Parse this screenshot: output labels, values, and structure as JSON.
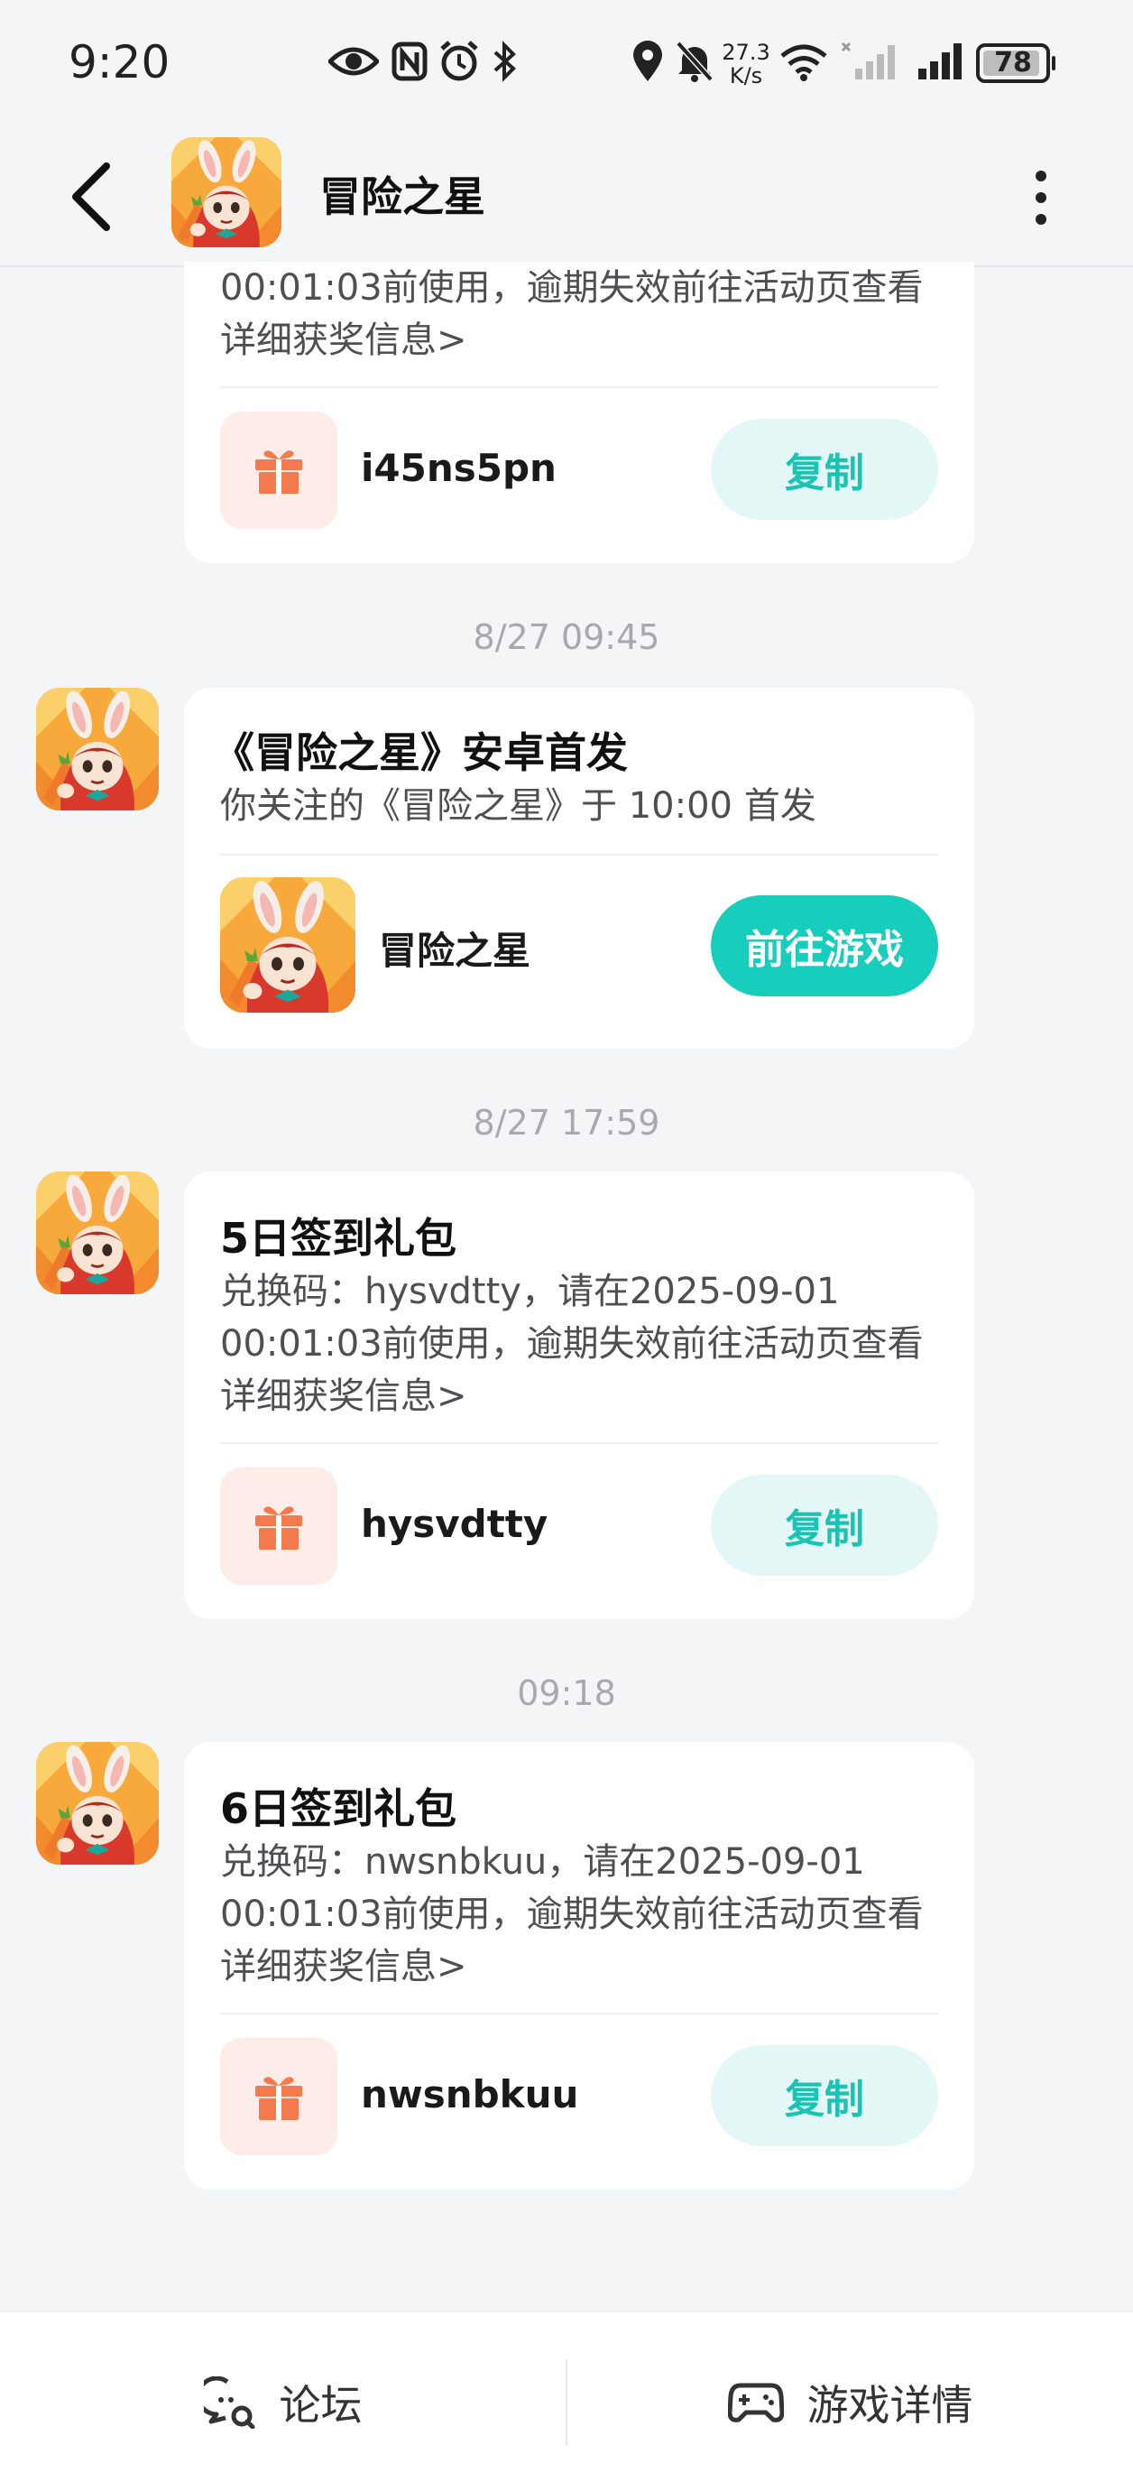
{
  "status_bar": {
    "time": "9:20",
    "net_speed_value": "27.3",
    "net_speed_unit": "K/s",
    "battery": "78",
    "icons": [
      "eye-icon",
      "nfc-icon",
      "alarm-icon",
      "bluetooth-icon",
      "location-icon",
      "mute-icon",
      "wifi-icon",
      "signal-icon",
      "battery-icon"
    ]
  },
  "header": {
    "title": "冒险之星",
    "back_icon": "chevron-left-icon",
    "more_icon": "more-vertical-icon"
  },
  "messages": [
    {
      "type": "gift_partial",
      "desc": "00:01:03前使用，逾期失效前往活动页查看详细获奖信息>",
      "code": "i45ns5pn",
      "button": "复制"
    },
    {
      "type": "launch",
      "timestamp": "8/27  09:45",
      "title": "《冒险之星》安卓首发",
      "desc": "你关注的《冒险之星》于 10:00 首发",
      "game_name": "冒险之星",
      "button": "前往游戏"
    },
    {
      "type": "gift",
      "timestamp": "8/27  17:59",
      "title": "5日签到礼包",
      "desc": "兑换码：hysvdtty，请在2025-09-01 00:01:03前使用，逾期失效前往活动页查看详细获奖信息>",
      "code": "hysvdtty",
      "button": "复制"
    },
    {
      "type": "gift",
      "timestamp": "09:18",
      "title": "6日签到礼包",
      "desc": "兑换码：nwsnbkuu，请在2025-09-01 00:01:03前使用，逾期失效前往活动页查看详细获奖信息>",
      "code": "nwsnbkuu",
      "button": "复制"
    }
  ],
  "bottom_bar": {
    "forum_label": "论坛",
    "details_label": "游戏详情"
  },
  "colors": {
    "accent": "#17cdbb",
    "copy_bg": "#e3f8f6",
    "gift_icon": "#f47a4e",
    "page_bg": "#f4f5f7"
  }
}
